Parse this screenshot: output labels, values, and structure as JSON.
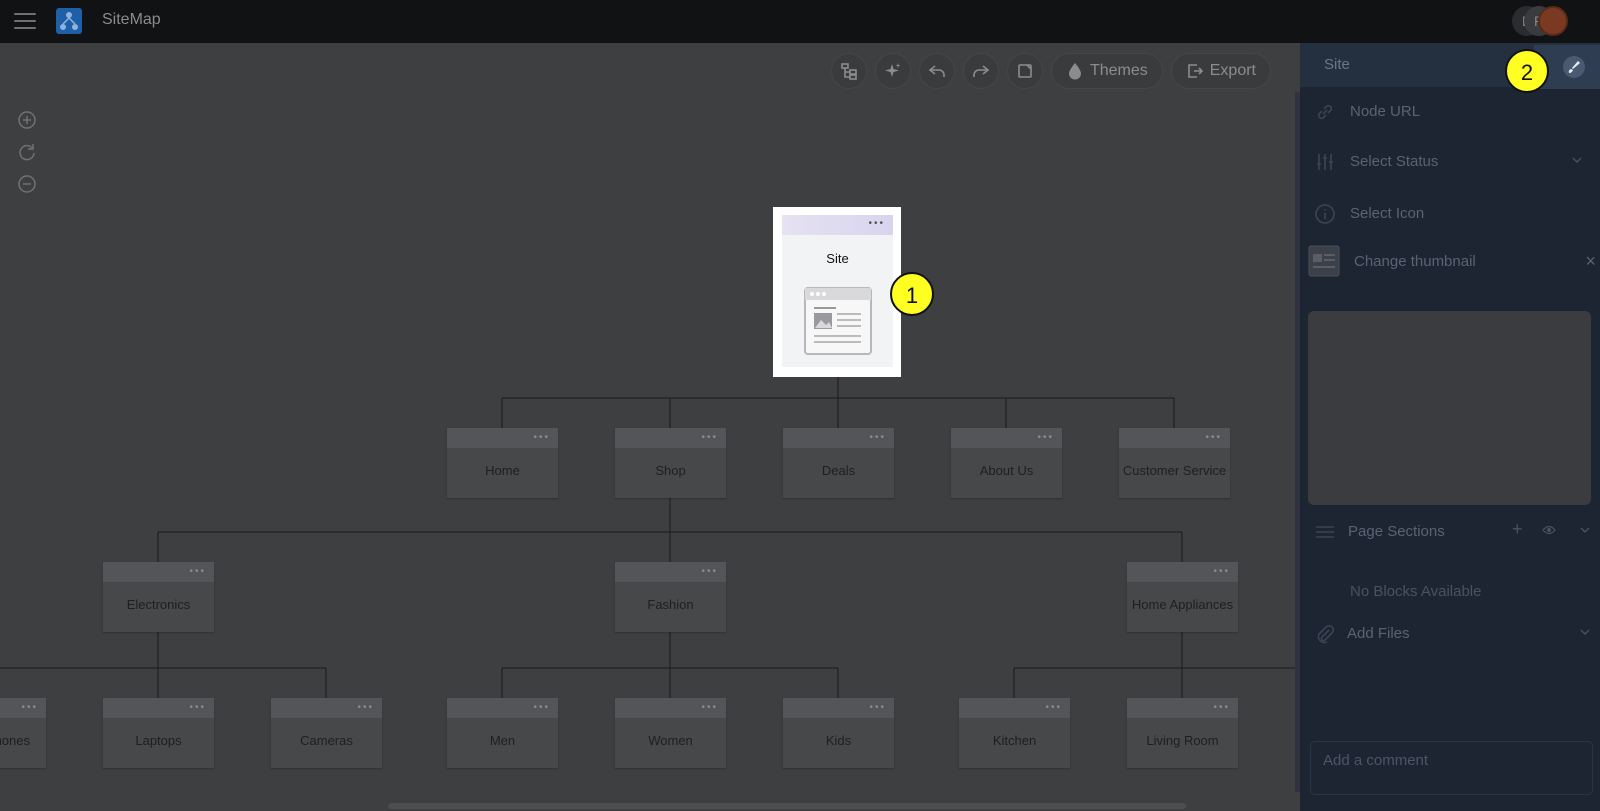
{
  "app": {
    "title": "SiteMap",
    "menu_icon": "hamburger-icon",
    "logo_icon": "sitemap-logo-icon"
  },
  "avatars": [
    "D",
    "R",
    ""
  ],
  "toolbar": {
    "buttons": [
      {
        "icon": "tree-layout-icon"
      },
      {
        "icon": "ai-sparkle-icon"
      },
      {
        "icon": "undo-icon"
      },
      {
        "icon": "redo-icon"
      },
      {
        "icon": "frame-icon"
      },
      {
        "icon": "droplet-icon",
        "label": "Themes"
      },
      {
        "icon": "export-icon",
        "label": "Export"
      }
    ]
  },
  "zoom": {
    "in_icon": "zoom-in-icon",
    "reset_icon": "reset-zoom-icon",
    "out_icon": "zoom-out-icon"
  },
  "tree": {
    "root": {
      "label": "Site",
      "dots": "•••"
    },
    "level1": [
      "Home",
      "Shop",
      "Deals",
      "About Us",
      "Customer Service"
    ],
    "level2": [
      "Electronics",
      "Fashion",
      "Home Appliances"
    ],
    "level3": [
      "hones",
      "Laptops",
      "Cameras",
      "Men",
      "Women",
      "Kids",
      "Kitchen",
      "Living Room"
    ],
    "dots": "•••"
  },
  "callouts": [
    "1",
    "2"
  ],
  "panel": {
    "title": "Site",
    "node_url": "Node URL",
    "select_status": "Select Status",
    "select_icon": "Select Icon",
    "change_thumbnail": "Change thumbnail",
    "page_sections": "Page Sections",
    "no_blocks": "No Blocks Available",
    "add_files": "Add Files",
    "comment_placeholder": "Add a comment",
    "close_glyph": "×",
    "add_glyph": "+"
  },
  "colors": {
    "callout": "#ffff22",
    "panel_bg": "#1d2432",
    "canvas_bg": "#3e3f41"
  }
}
